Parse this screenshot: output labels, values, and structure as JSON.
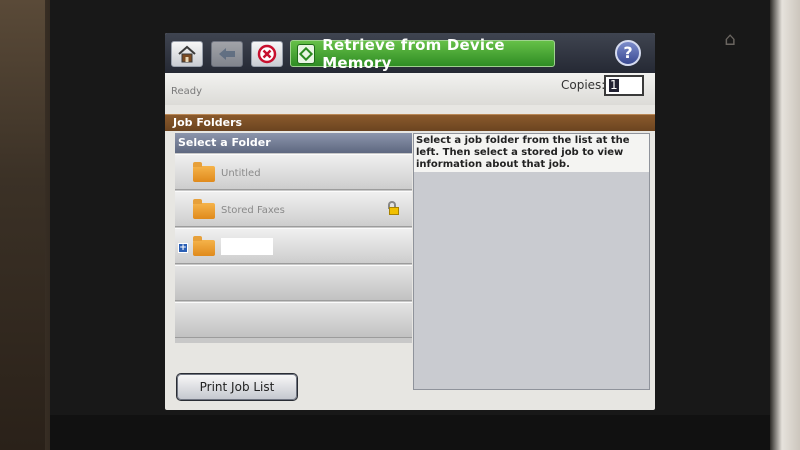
{
  "window": {
    "title": "Retrieve from Device Memory",
    "status": "Ready"
  },
  "toolbar": {
    "home_icon": "home-icon",
    "back_icon": "back-arrow-icon",
    "stop_icon": "stop-icon",
    "title_icon": "go-diamond-icon",
    "help_label": "?"
  },
  "copies": {
    "label": "Copies:",
    "value": "1"
  },
  "job_folders": {
    "header": "Job Folders",
    "select_header": "Select a Folder",
    "folders": [
      {
        "label": "Untitled",
        "locked": false,
        "expandable": false
      },
      {
        "label": "Stored Faxes",
        "locked": true,
        "expandable": false
      },
      {
        "label": "",
        "locked": false,
        "expandable": true,
        "redacted": true
      }
    ]
  },
  "info_text": "Select a job folder from the list at the left. Then select a stored job to view information about that job.",
  "print_job_list_label": "Print Job List",
  "colors": {
    "title_green": "#3fa02f",
    "folder_header_brown": "#7a4e25",
    "select_header_blue": "#6d7690",
    "folder_orange": "#eca036"
  }
}
